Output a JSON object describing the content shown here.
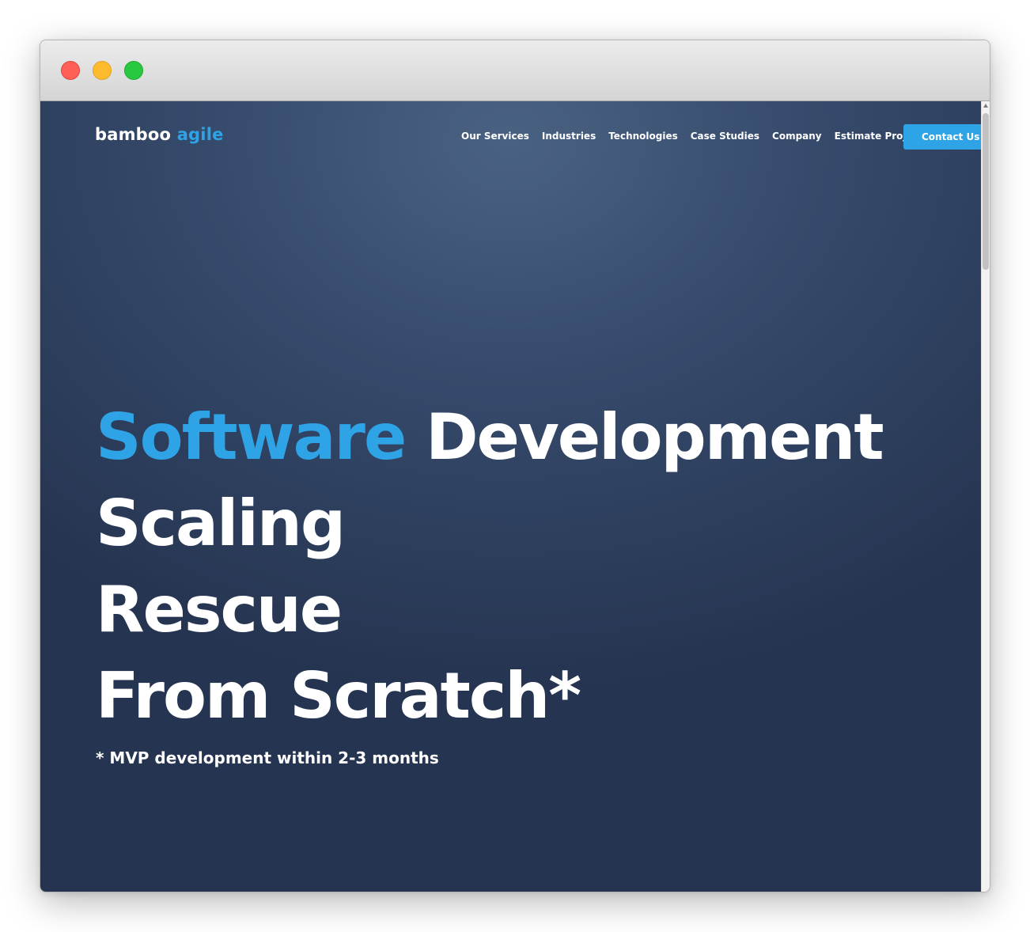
{
  "window": {
    "controls": [
      "close",
      "minimize",
      "maximize"
    ]
  },
  "header": {
    "logo": {
      "word1": "bamboo",
      "word2": "agile"
    },
    "nav": [
      "Our Services",
      "Industries",
      "Technologies",
      "Case Studies",
      "Company",
      "Estimate Project"
    ],
    "cta_label": "Contact Us"
  },
  "hero": {
    "line1_accent": "Software",
    "line1_rest": "Development",
    "line2": "Scaling",
    "line3": "Rescue",
    "line4": "From Scratch*",
    "footnote": "* MVP development within 2-3 months"
  },
  "colors": {
    "accent": "#2ea3e6",
    "background_top": "#4a6282",
    "background_bottom": "#253450",
    "text": "#ffffff"
  }
}
